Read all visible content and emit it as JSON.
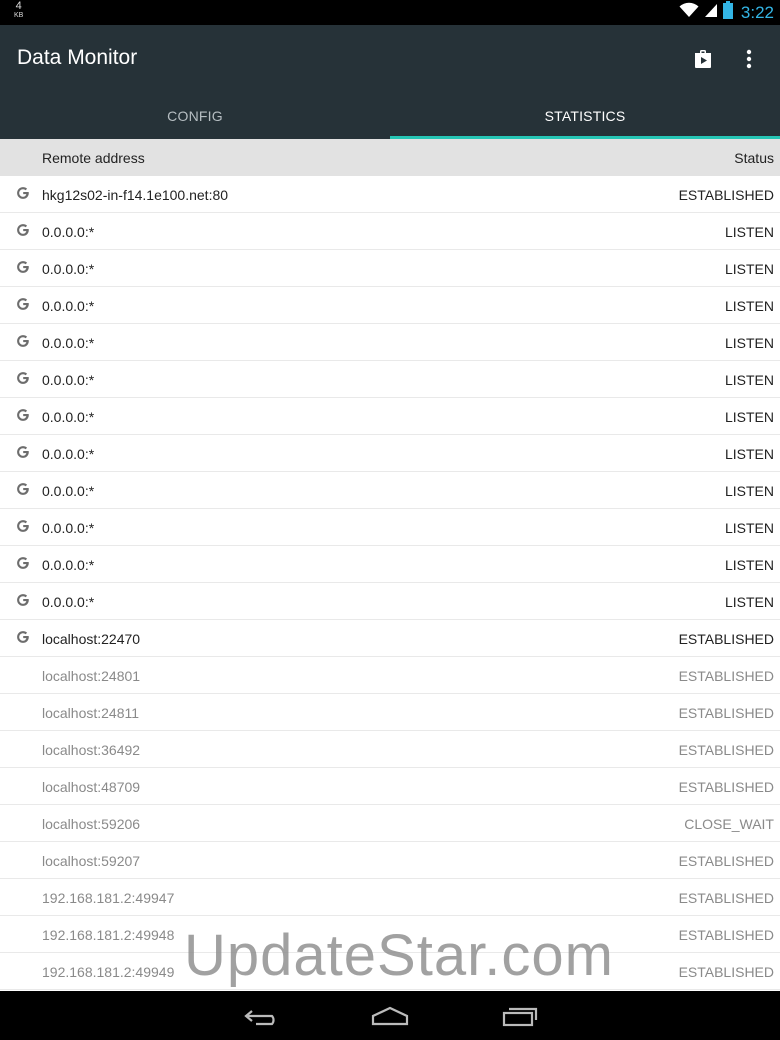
{
  "status_bar": {
    "traffic_value": "4",
    "traffic_unit": "KB",
    "time": "3:22",
    "icons": [
      "wifi-icon",
      "signal-icon",
      "battery-icon"
    ]
  },
  "app_bar": {
    "title": "Data Monitor",
    "actions": [
      "store-icon",
      "more-vert-icon"
    ]
  },
  "tabs": [
    {
      "label": "CONFIG",
      "active": false
    },
    {
      "label": "STATISTICS",
      "active": true
    }
  ],
  "table": {
    "headers": {
      "address": "Remote address",
      "status": "Status"
    },
    "rows": [
      {
        "icon": "google-icon",
        "address": "hkg12s02-in-f14.1e100.net:80",
        "status": "ESTABLISHED",
        "dim": false
      },
      {
        "icon": "google-icon",
        "address": "0.0.0.0:*",
        "status": "LISTEN",
        "dim": false
      },
      {
        "icon": "google-icon",
        "address": "0.0.0.0:*",
        "status": "LISTEN",
        "dim": false
      },
      {
        "icon": "google-icon",
        "address": "0.0.0.0:*",
        "status": "LISTEN",
        "dim": false
      },
      {
        "icon": "google-icon",
        "address": "0.0.0.0:*",
        "status": "LISTEN",
        "dim": false
      },
      {
        "icon": "google-icon",
        "address": "0.0.0.0:*",
        "status": "LISTEN",
        "dim": false
      },
      {
        "icon": "google-icon",
        "address": "0.0.0.0:*",
        "status": "LISTEN",
        "dim": false
      },
      {
        "icon": "google-icon",
        "address": "0.0.0.0:*",
        "status": "LISTEN",
        "dim": false
      },
      {
        "icon": "google-icon",
        "address": "0.0.0.0:*",
        "status": "LISTEN",
        "dim": false
      },
      {
        "icon": "google-icon",
        "address": "0.0.0.0:*",
        "status": "LISTEN",
        "dim": false
      },
      {
        "icon": "google-icon",
        "address": "0.0.0.0:*",
        "status": "LISTEN",
        "dim": false
      },
      {
        "icon": "google-icon",
        "address": "0.0.0.0:*",
        "status": "LISTEN",
        "dim": false
      },
      {
        "icon": "google-icon",
        "address": "localhost:22470",
        "status": "ESTABLISHED",
        "dim": false
      },
      {
        "icon": "",
        "address": "localhost:24801",
        "status": "ESTABLISHED",
        "dim": true
      },
      {
        "icon": "",
        "address": "localhost:24811",
        "status": "ESTABLISHED",
        "dim": true
      },
      {
        "icon": "",
        "address": "localhost:36492",
        "status": "ESTABLISHED",
        "dim": true
      },
      {
        "icon": "",
        "address": "localhost:48709",
        "status": "ESTABLISHED",
        "dim": true
      },
      {
        "icon": "",
        "address": "localhost:59206",
        "status": "CLOSE_WAIT",
        "dim": true
      },
      {
        "icon": "",
        "address": "localhost:59207",
        "status": "ESTABLISHED",
        "dim": true
      },
      {
        "icon": "",
        "address": "192.168.181.2:49947",
        "status": "ESTABLISHED",
        "dim": true
      },
      {
        "icon": "",
        "address": "192.168.181.2:49948",
        "status": "ESTABLISHED",
        "dim": true
      },
      {
        "icon": "",
        "address": "192.168.181.2:49949",
        "status": "ESTABLISHED",
        "dim": true
      }
    ]
  },
  "watermark": "UpdateStar.com",
  "nav_bar": {
    "icons": [
      "back-icon",
      "home-icon",
      "recents-icon"
    ]
  },
  "colors": {
    "app_bar": "#263238",
    "tab_indicator": "#26c6b5",
    "clock": "#33b5e5"
  }
}
